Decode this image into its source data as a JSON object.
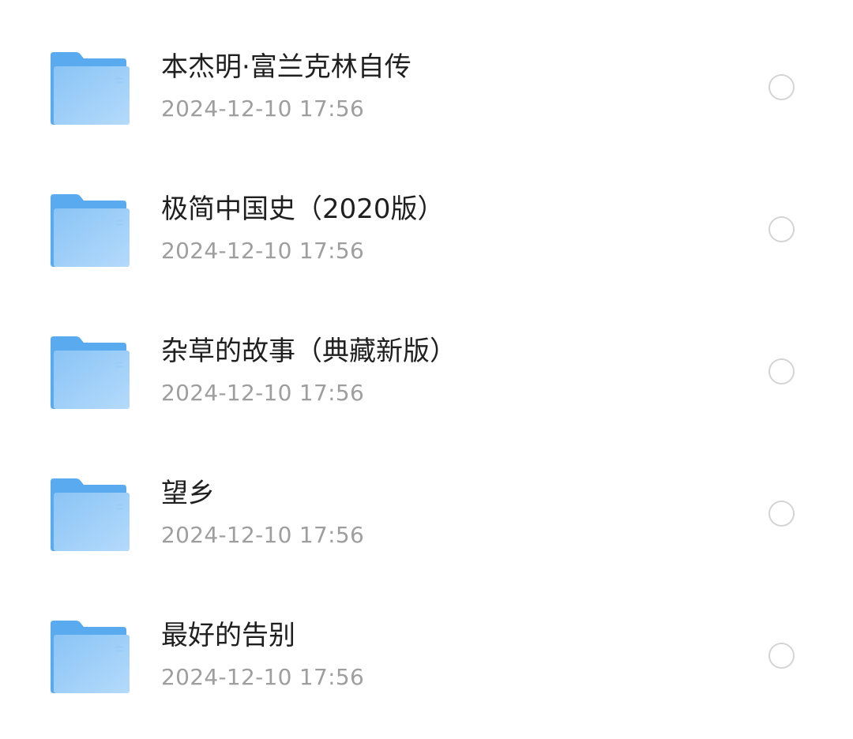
{
  "colors": {
    "folder_back": "#5aaaf0",
    "folder_front_top": "#8ac4f6",
    "folder_front_bottom": "#b4dafb",
    "title": "#1f1f1f",
    "meta": "#9e9e9e",
    "radio_border": "#d4d4d4"
  },
  "items": [
    {
      "icon": "folder-icon",
      "name": "本杰明·富兰克林自传",
      "date": "2024-12-10 17:56",
      "selected": false
    },
    {
      "icon": "folder-icon",
      "name": "极简中国史（2020版）",
      "date": "2024-12-10 17:56",
      "selected": false
    },
    {
      "icon": "folder-icon",
      "name": "杂草的故事（典藏新版）",
      "date": "2024-12-10 17:56",
      "selected": false
    },
    {
      "icon": "folder-icon",
      "name": "望乡",
      "date": "2024-12-10 17:56",
      "selected": false
    },
    {
      "icon": "folder-icon",
      "name": "最好的告别",
      "date": "2024-12-10 17:56",
      "selected": false
    }
  ]
}
